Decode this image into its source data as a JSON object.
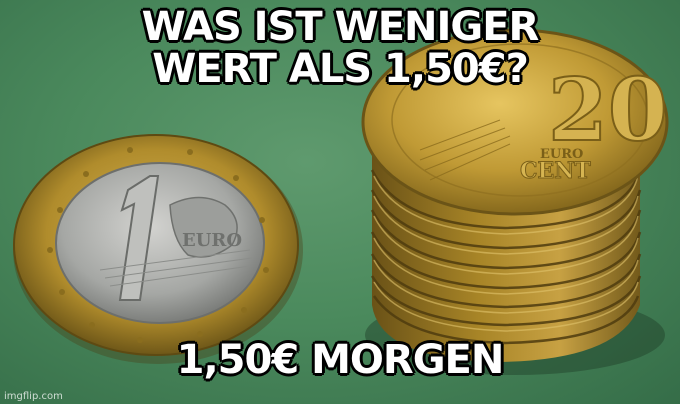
{
  "meme": {
    "top_text_line1": "WAS IST WENIGER",
    "top_text_line2": "WERT ALS 1,50€?",
    "bottom_text": "1,50€ MORGEN",
    "watermark": "imgflip.com"
  },
  "photo": {
    "left_coin_label": "1 EURO",
    "stack_coin_label": "20 EURO CENT",
    "colors": {
      "background": "#4b8a5d",
      "coin_gold": "#b8962e",
      "coin_silver": "#a7a9a6"
    }
  }
}
